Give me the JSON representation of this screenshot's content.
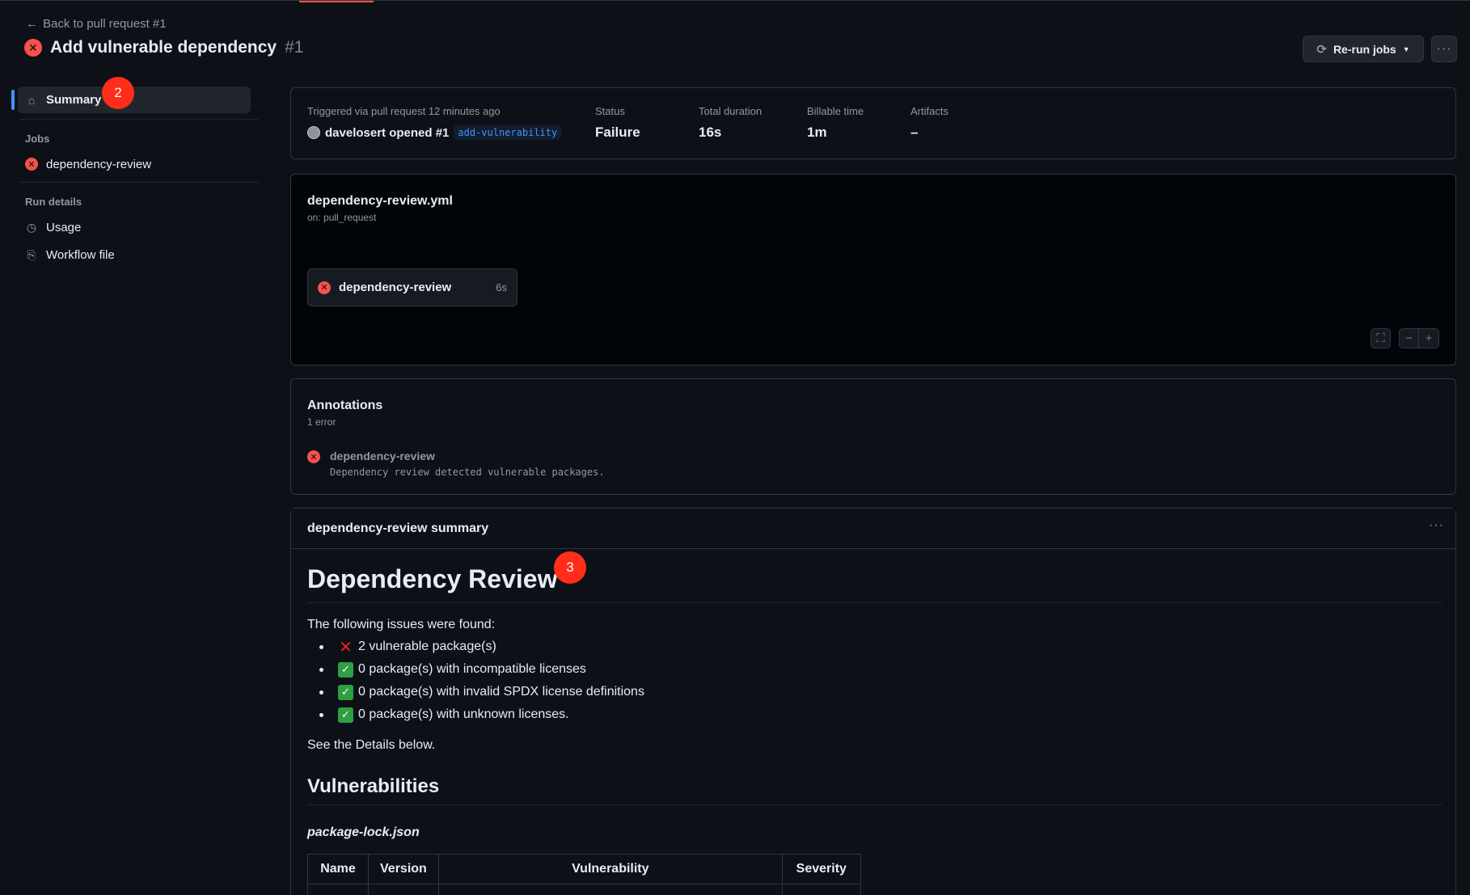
{
  "header": {
    "back_label": "Back to pull request #1",
    "title": "Add vulnerable dependency",
    "run_number": "#1",
    "rerun_label": "Re-run jobs"
  },
  "sidebar": {
    "summary_label": "Summary",
    "jobs_heading": "Jobs",
    "jobs": [
      {
        "label": "dependency-review",
        "status": "failure"
      }
    ],
    "run_details_heading": "Run details",
    "usage_label": "Usage",
    "workflow_file_label": "Workflow file"
  },
  "markers": {
    "sidebar": "2",
    "summary": "3"
  },
  "meta": {
    "triggered": "Triggered via pull request 12 minutes ago",
    "actor_text": "davelosert opened #1",
    "branch": "add-vulnerability",
    "status_label": "Status",
    "status_value": "Failure",
    "duration_label": "Total duration",
    "duration_value": "16s",
    "billable_label": "Billable time",
    "billable_value": "1m",
    "artifacts_label": "Artifacts",
    "artifacts_value": "–"
  },
  "graph": {
    "workflow_file": "dependency-review.yml",
    "trigger": "on: pull_request",
    "job_name": "dependency-review",
    "job_duration": "6s"
  },
  "annotations": {
    "title": "Annotations",
    "count": "1 error",
    "items": [
      {
        "job": "dependency-review",
        "message": "Dependency review detected vulnerable packages."
      }
    ]
  },
  "summary": {
    "header": "dependency-review summary",
    "heading": "Dependency Review",
    "intro": "The following issues were found:",
    "issues": [
      {
        "icon": "cross-mark",
        "text": "2 vulnerable package(s)"
      },
      {
        "icon": "check-mark",
        "text": "0 package(s) with incompatible licenses"
      },
      {
        "icon": "check-mark",
        "text": "0 package(s) with invalid SPDX license definitions"
      },
      {
        "icon": "check-mark",
        "text": "0 package(s) with unknown licenses."
      }
    ],
    "see_details": "See the Details below.",
    "vuln_heading": "Vulnerabilities",
    "lockfile": "package-lock.json",
    "table_headers": [
      "Name",
      "Version",
      "Vulnerability",
      "Severity"
    ]
  },
  "colors": {
    "failure": "#f85149",
    "accent": "#4493f8",
    "marker": "#ff2d1a"
  }
}
